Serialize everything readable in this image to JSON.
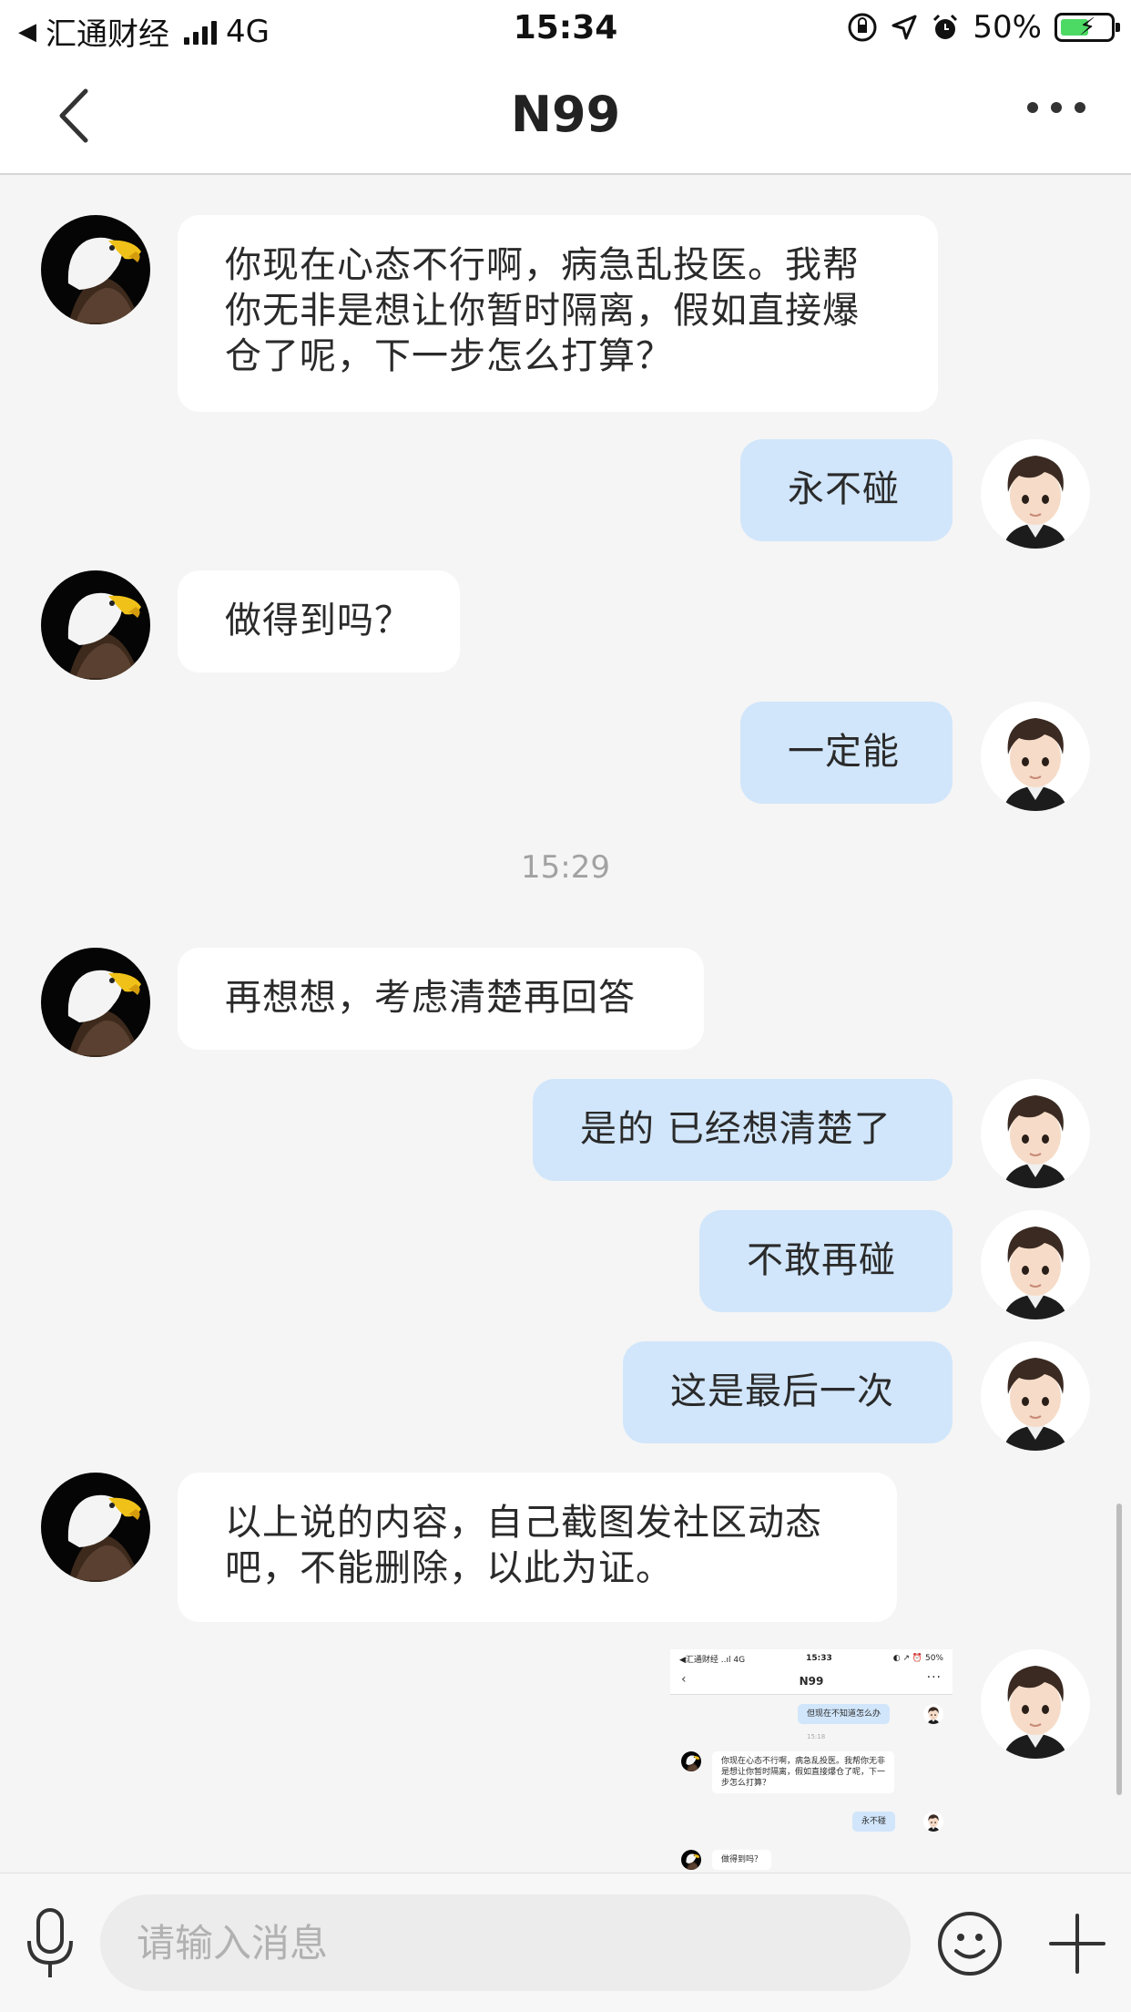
{
  "status_bar": {
    "carrier": "汇通财经",
    "network": "4G",
    "time": "15:34",
    "battery": "50%"
  },
  "header": {
    "title": "N99"
  },
  "messages": [
    {
      "side": "in",
      "text": "你现在心态不行啊，病急乱投医。我帮你无非是想让你暂时隔离，假如直接爆仓了呢，下一步怎么打算？"
    },
    {
      "side": "out",
      "text": "永不碰"
    },
    {
      "side": "in",
      "text": "做得到吗？"
    },
    {
      "side": "out",
      "text": "一定能"
    },
    {
      "side": "out",
      "text": "是的 已经想清楚了"
    },
    {
      "side": "in",
      "text": "再想想，考虑清楚再回答"
    },
    {
      "side": "out",
      "text": "不敢再碰"
    },
    {
      "side": "out",
      "text": "这是最后一次"
    },
    {
      "side": "in",
      "text": "以上说的内容，自己截图发社区动态吧，不能删除，以此为证。"
    }
  ],
  "timestamp": "15:29",
  "thumbnail": {
    "status_carrier": "◀汇通财经 ..ıl 4G",
    "status_time": "15:33",
    "status_battery": "◐ ↗ ⏰ 50%",
    "title": "N99",
    "bubble_1": "但现在不知道怎么办",
    "timestamp": "15:18",
    "bubble_2": "你现在心态不行啊，病急乱投医。我帮你无非是想让你暂时隔离，假如直接爆仓了呢，下一步怎么打算？",
    "bubble_3": "永不碰",
    "bubble_4": "做得到吗？"
  },
  "input": {
    "placeholder": "请输入消息"
  }
}
